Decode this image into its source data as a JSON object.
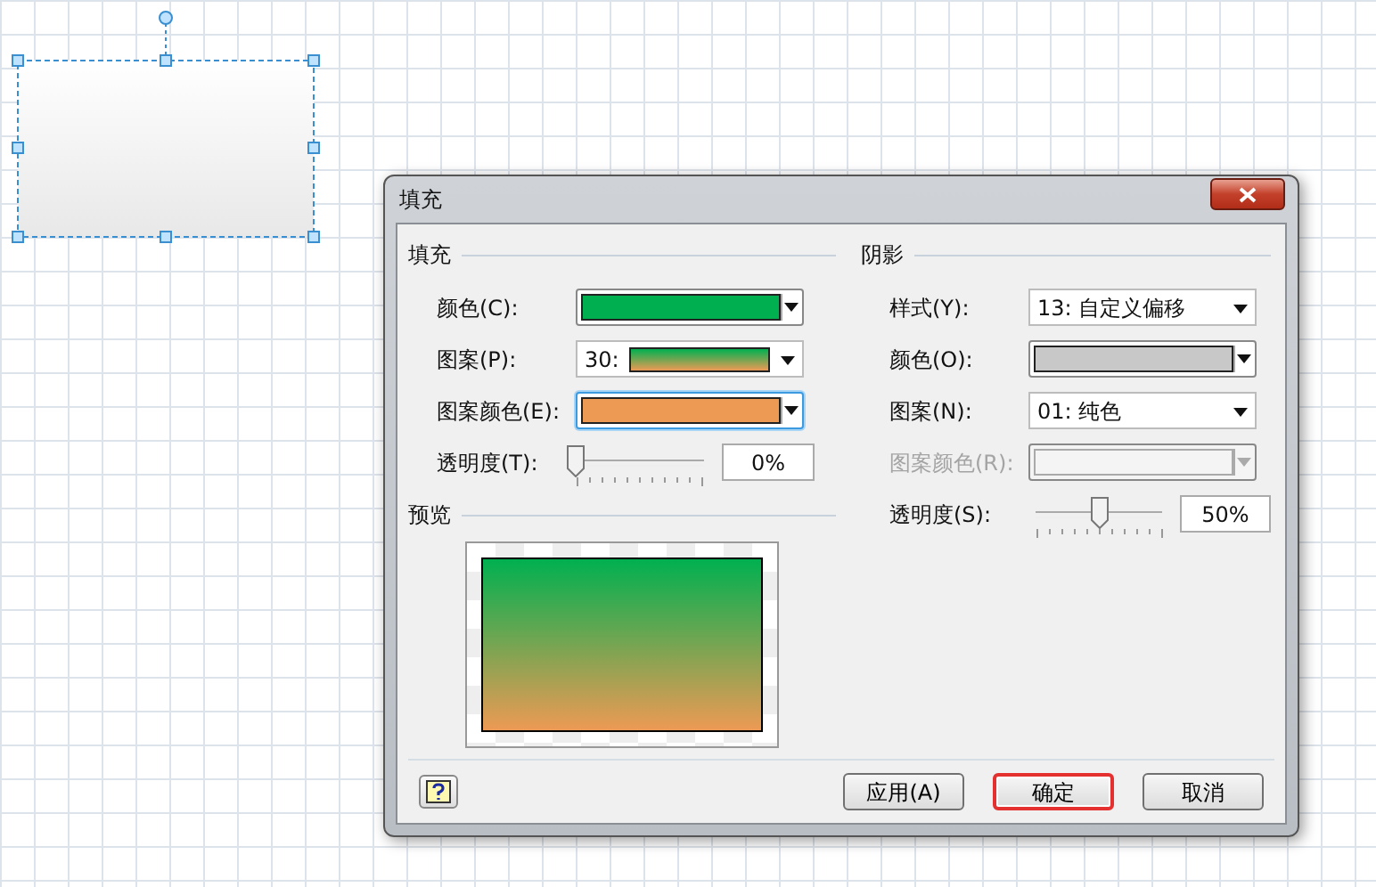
{
  "window": {
    "title": "填充"
  },
  "fill": {
    "heading": "填充",
    "fields": [
      {
        "kind": "color",
        "label": "颜色(C):",
        "color": "#00b050",
        "focused": false,
        "disabled": false
      },
      {
        "kind": "pattern",
        "label": "图案(P):",
        "value": "30:",
        "focused": false
      },
      {
        "kind": "color",
        "label": "图案颜色(E):",
        "color": "#ed9a54",
        "focused": true,
        "disabled": false
      },
      {
        "kind": "slider",
        "label": "透明度(T):",
        "level": 0,
        "reading": "0%"
      }
    ]
  },
  "preview": {
    "heading": "预览"
  },
  "shadow": {
    "heading": "阴影",
    "fields": [
      {
        "kind": "select",
        "label": "样式(Y):",
        "value": "13: 自定义偏移"
      },
      {
        "kind": "color",
        "label": "颜色(O):",
        "color": "#c8c8c8",
        "focused": false,
        "disabled": false
      },
      {
        "kind": "select",
        "label": "图案(N):",
        "value": "01: 纯色"
      },
      {
        "kind": "color",
        "label": "图案颜色(R):",
        "focused": false,
        "disabled": true
      },
      {
        "kind": "slider",
        "label": "透明度(S):",
        "level": 0.5,
        "reading": "50%"
      }
    ]
  },
  "buttons": [
    {
      "label": "应用(A)",
      "highlighted": false
    },
    {
      "label": "确定",
      "highlighted": true
    },
    {
      "label": "取消",
      "highlighted": false
    }
  ]
}
